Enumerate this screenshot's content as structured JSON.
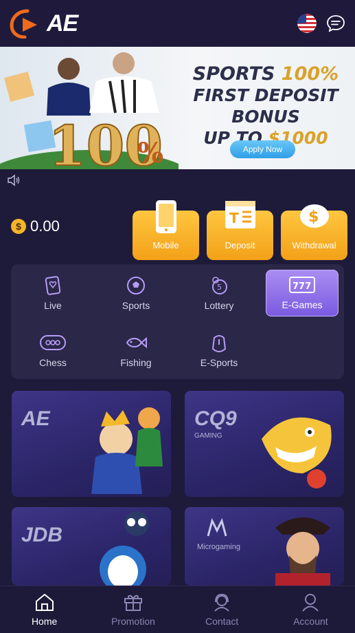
{
  "header": {
    "logo_text": "AE",
    "language_icon": "us-flag-icon",
    "chat_icon": "chat-bubble-icon"
  },
  "banner": {
    "line1_a": "SPORTS ",
    "line1_b": "100%",
    "line2": "FIRST DEPOSIT BONUS",
    "line3_a": "UP TO ",
    "line3_b": "$1000",
    "big_number": "100",
    "apply_label": "Apply Now"
  },
  "balance": {
    "currency_symbol": "$",
    "amount": "0.00"
  },
  "quick_actions": [
    {
      "label": "Mobile",
      "icon": "mobile-phone-icon"
    },
    {
      "label": "Deposit",
      "icon": "deposit-icon"
    },
    {
      "label": "Withdrawal",
      "icon": "piggy-bank-icon"
    }
  ],
  "categories": [
    {
      "label": "Live",
      "icon": "live-cards-icon"
    },
    {
      "label": "Sports",
      "icon": "soccer-ball-icon"
    },
    {
      "label": "Lottery",
      "icon": "lottery-balls-icon"
    },
    {
      "label": "E-Games",
      "icon": "slot-777-icon",
      "active": true
    },
    {
      "label": "Chess",
      "icon": "chess-icon"
    },
    {
      "label": "Fishing",
      "icon": "fish-icon"
    },
    {
      "label": "E-Sports",
      "icon": "gamepad-icon"
    }
  ],
  "providers": [
    {
      "brand": "AE"
    },
    {
      "brand": "CQ9",
      "sub": "GAMING"
    },
    {
      "brand": "JDB"
    },
    {
      "brand": "Microgaming"
    }
  ],
  "tabbar": [
    {
      "label": "Home",
      "icon": "home-icon",
      "active": true
    },
    {
      "label": "Promotion",
      "icon": "gift-icon"
    },
    {
      "label": "Contact",
      "icon": "headset-icon"
    },
    {
      "label": "Account",
      "icon": "user-icon"
    }
  ],
  "colors": {
    "background": "#1e1a3a",
    "accent_orange": "#f3a118",
    "active_purple": "#8e6de9"
  }
}
